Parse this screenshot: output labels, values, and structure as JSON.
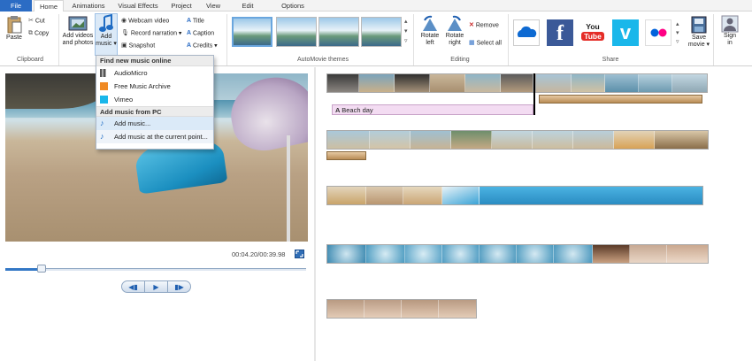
{
  "tabs": [
    "File",
    "Home",
    "Animations",
    "Visual Effects",
    "Project",
    "View",
    "Edit",
    "Options"
  ],
  "clipboard": {
    "paste": "Paste",
    "cut": "Cut",
    "copy": "Copy",
    "group": "Clipboard"
  },
  "add": {
    "videos_line1": "Add videos",
    "videos_line2": "and photos",
    "music_line1": "Add",
    "music_line2": "music ▾",
    "webcam": "Webcam video",
    "narration": "Record narration ▾",
    "snapshot": "Snapshot",
    "title": "Title",
    "caption": "Caption",
    "credits": "Credits ▾"
  },
  "themes": {
    "group": "AutoMovie themes",
    "count": 4
  },
  "editing": {
    "rotate_left_1": "Rotate",
    "rotate_left_2": "left",
    "rotate_right_1": "Rotate",
    "rotate_right_2": "right",
    "remove": "Remove",
    "select_all": "Select all",
    "group": "Editing"
  },
  "share": {
    "group": "Share",
    "services": [
      "onedrive-icon",
      "facebook-icon",
      "youtube-icon",
      "vimeo-icon",
      "flickr-icon"
    ],
    "youtube_1": "You",
    "youtube_2": "Tube",
    "save_1": "Save",
    "save_2": "movie ▾",
    "signin_1": "Sign",
    "signin_2": "in"
  },
  "menu": {
    "online_header": "Find new music online",
    "online_items": [
      "AudioMicro",
      "Free Music Archive",
      "Vimeo"
    ],
    "pc_header": "Add music from PC",
    "pc_items": [
      "Add music...",
      "Add music at the current point..."
    ]
  },
  "player": {
    "time": "00:04.20/00:39.98",
    "progress": 0.12
  },
  "timeline": {
    "caption": "Beach day"
  },
  "colors": {
    "accent": "#2b6cc4",
    "facebook": "#3b5998",
    "youtube": "#e52d27",
    "vimeo": "#1ab7ea",
    "onedrive": "#0e6ad2"
  }
}
